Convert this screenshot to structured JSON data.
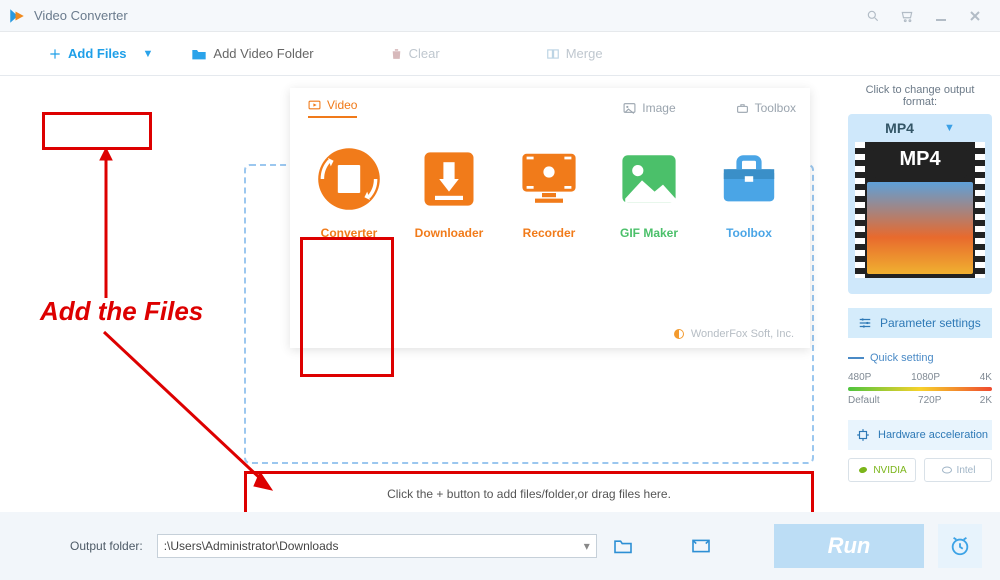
{
  "title": "Video Converter",
  "toolbar": {
    "add_files": "Add Files",
    "add_folder": "Add Video Folder",
    "clear": "Clear",
    "merge": "Merge"
  },
  "panel": {
    "tabs": {
      "video": "Video",
      "image": "Image",
      "toolbox": "Toolbox"
    },
    "tiles": {
      "converter": "Converter",
      "downloader": "Downloader",
      "recorder": "Recorder",
      "gif": "GIF Maker",
      "toolbox": "Toolbox"
    },
    "footer": "WonderFox Soft, Inc."
  },
  "drop_hint": "Click the + button to add files/folder,or drag files here.",
  "annotation": {
    "text": "Add the Files"
  },
  "sidebar": {
    "format_hint": "Click to change output format:",
    "format_selected": "MP4",
    "format_badge": "MP4",
    "parameter": "Parameter settings",
    "quick_title": "Quick setting",
    "q_top": [
      "480P",
      "1080P",
      "4K"
    ],
    "q_bot": [
      "Default",
      "720P",
      "2K"
    ],
    "hw": "Hardware acceleration",
    "vendors": [
      "NVIDIA",
      "Intel"
    ]
  },
  "bottom": {
    "label": "Output folder:",
    "path": ":\\Users\\Administrator\\Downloads",
    "run": "Run"
  }
}
